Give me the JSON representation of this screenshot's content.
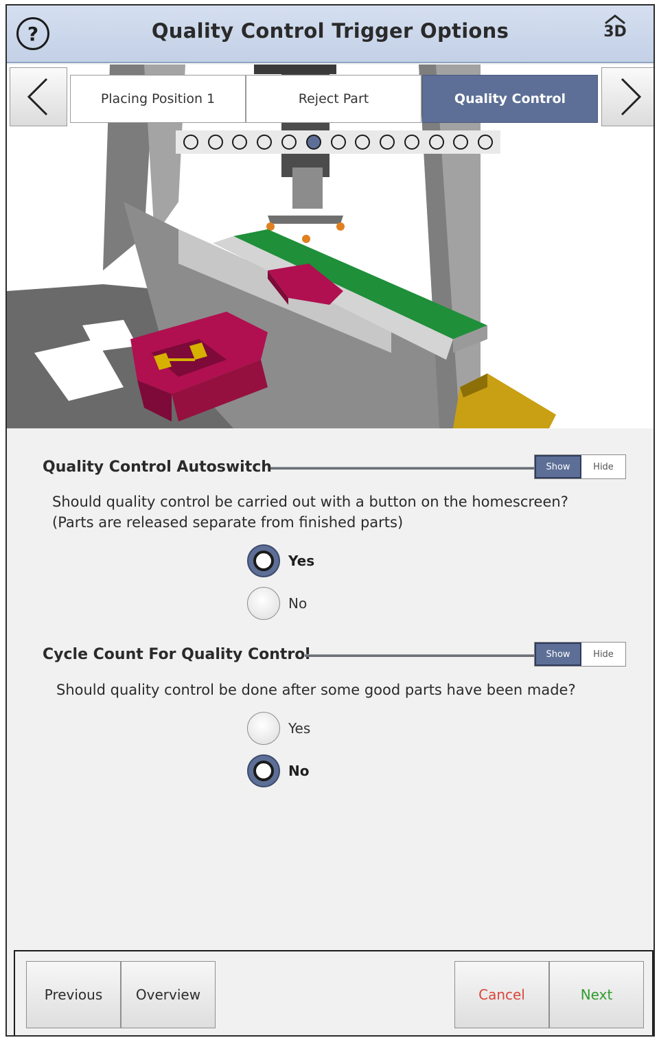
{
  "header": {
    "title": "Quality Control Trigger Options",
    "help_label": "?",
    "view3d_label": "3D"
  },
  "steps": {
    "tabs": [
      "Placing Position 1",
      "Reject Part",
      "Quality Control"
    ],
    "active_tab": 2,
    "dot_count": 13,
    "active_dot": 5
  },
  "sections": [
    {
      "title": "Quality Control Autoswitch",
      "toggle": {
        "show": "Show",
        "hide": "Hide",
        "selected": "Show"
      },
      "question_line1": "Should quality control be carried out with a button on the homescreen?",
      "question_line2": "(Parts are released separate from finished parts)",
      "options": [
        {
          "label": "Yes",
          "checked": true
        },
        {
          "label": "No",
          "checked": false
        }
      ]
    },
    {
      "title": "Cycle Count For Quality Control",
      "toggle": {
        "show": "Show",
        "hide": "Hide",
        "selected": "Show"
      },
      "question_line1": "Should quality control be done after some good parts have been made?",
      "options": [
        {
          "label": "Yes",
          "checked": false
        },
        {
          "label": "No",
          "checked": true
        }
      ]
    }
  ],
  "footer": {
    "previous": "Previous",
    "overview": "Overview",
    "cancel": "Cancel",
    "next": "Next"
  },
  "colors": {
    "accent": "#5d6f96",
    "header_bg": "#c9d5ea",
    "cancel_text": "#d9453a",
    "next_text": "#2f9a2f",
    "conveyor": "#1f8f3a",
    "part": "#b0104f",
    "bin": "#c9a013"
  },
  "icons": {
    "help": "question-circle-icon",
    "view3d": "3d-view-icon",
    "prev": "chevron-left-icon",
    "next": "chevron-right-icon"
  }
}
